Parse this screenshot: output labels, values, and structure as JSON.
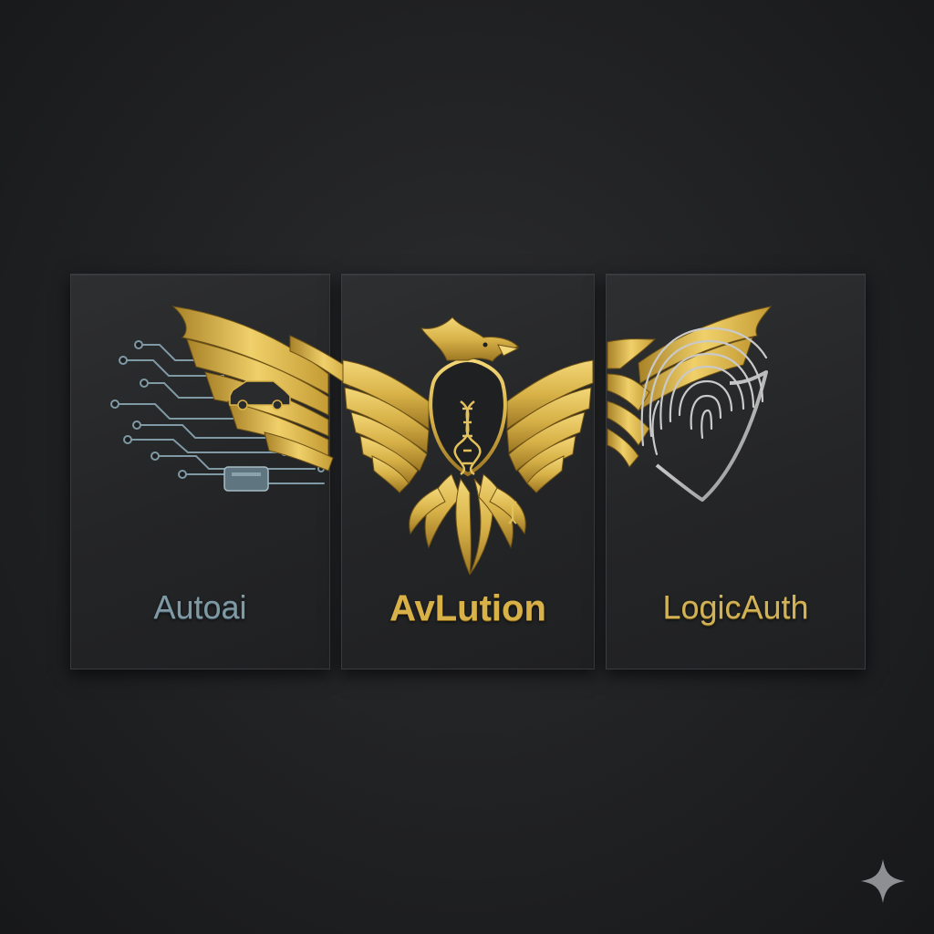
{
  "panels": [
    {
      "id": "autoai",
      "label": "Autoai",
      "accent": "#7f9aa5",
      "icon": "circuit-icon"
    },
    {
      "id": "avlution",
      "label": "AvLution",
      "accent": "#d8b248",
      "icon": "phoenix-dna-icon"
    },
    {
      "id": "logicauth",
      "label": "LogicAuth",
      "accent": "#d1b257",
      "icon": "fingerprint-shield-icon"
    }
  ],
  "colors": {
    "background": "#1e1f21",
    "panel": "#262729",
    "gold": "#d8b248",
    "gold_dark": "#8a6a1e",
    "steel": "#7f9aa5",
    "silver": "#c8c8c8"
  },
  "corner_mark_icon": "sparkle-icon"
}
